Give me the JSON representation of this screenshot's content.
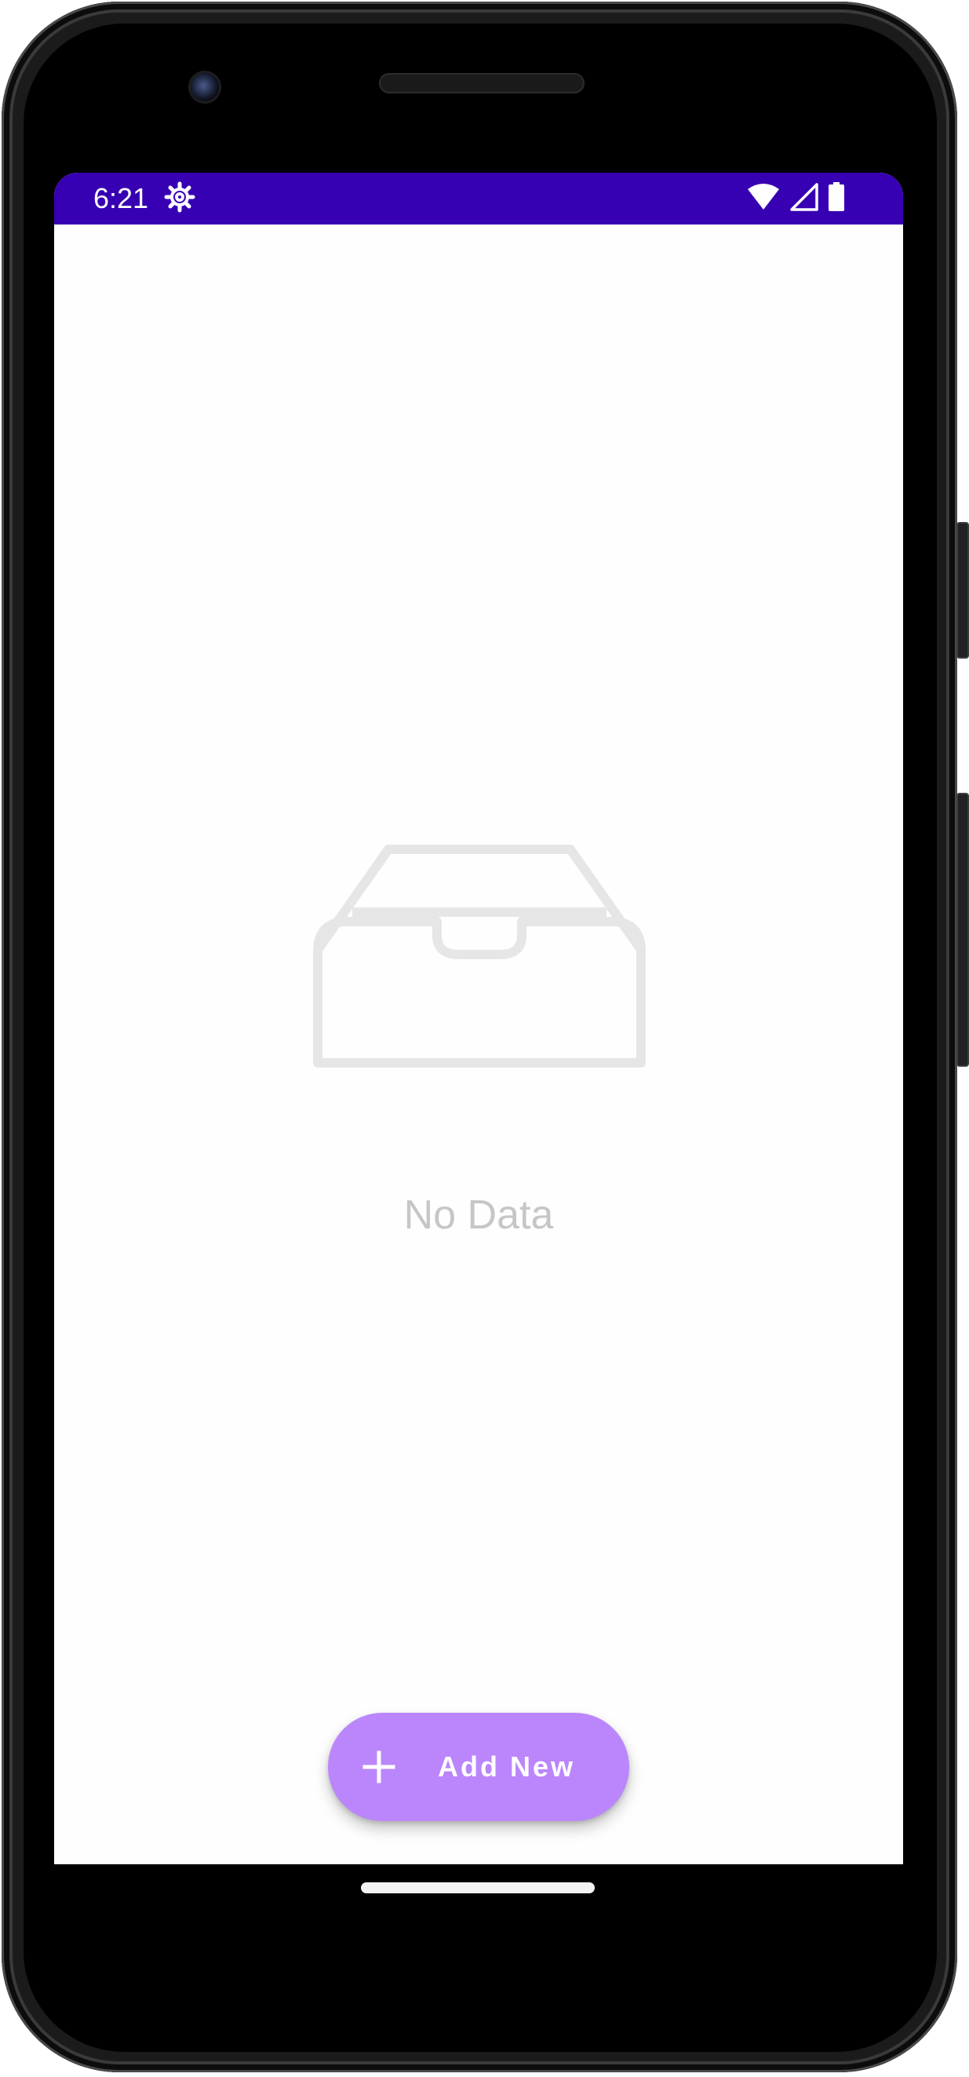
{
  "colors": {
    "status_bar": "#3700B3",
    "fab_background": "#BB86FC",
    "empty_icon": "#E6E6E6",
    "empty_text": "#C6C6C6"
  },
  "status_bar": {
    "time": "6:21",
    "icons": [
      "settings-icon",
      "wifi-icon",
      "cellular-signal-icon",
      "battery-icon"
    ]
  },
  "empty_state": {
    "icon": "inbox-tray-icon",
    "message": "No Data"
  },
  "fab": {
    "icon": "plus-icon",
    "label": "Add New"
  }
}
